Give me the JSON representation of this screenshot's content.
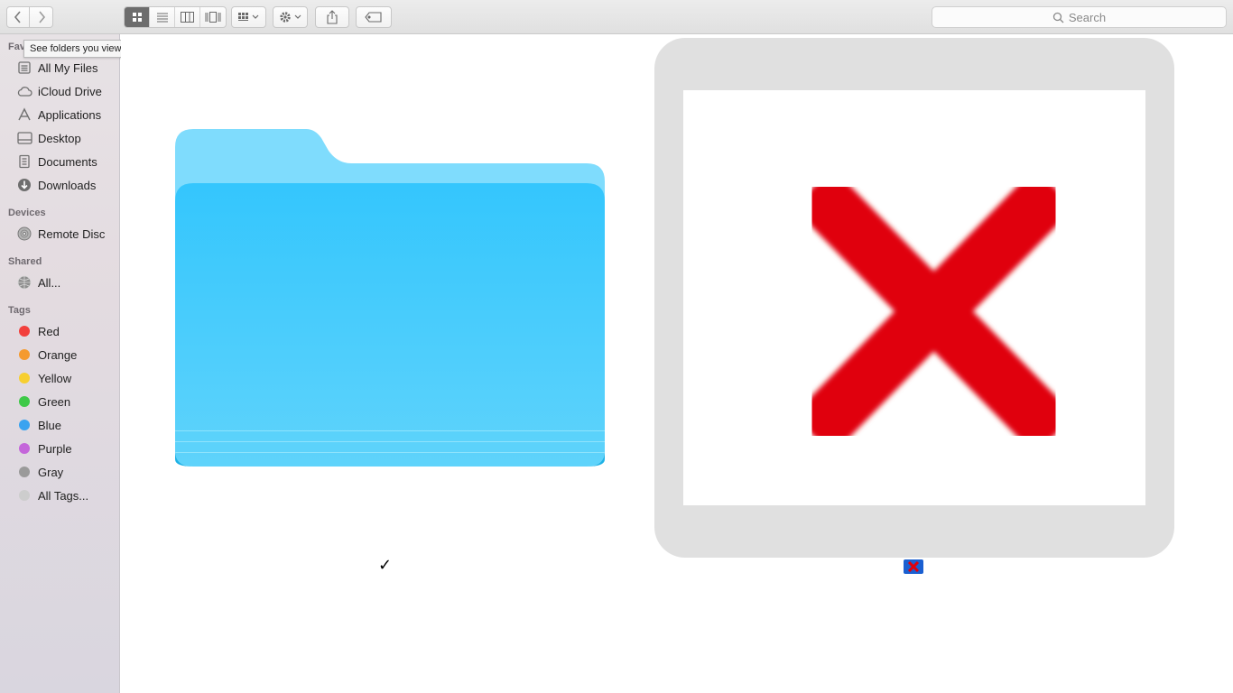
{
  "toolbar": {
    "back_icon": "chevron-left-icon",
    "forward_icon": "chevron-right-icon",
    "view_modes": [
      "icon-view-icon",
      "list-view-icon",
      "column-view-icon",
      "cover-flow-icon"
    ],
    "active_view": "icon-view-icon",
    "arrange_icon": "arrange-grid-icon",
    "action_icon": "gear-icon",
    "share_icon": "share-icon",
    "tag_icon": "tag-icon",
    "search_placeholder": "Search"
  },
  "tooltip": {
    "text": "See folders you viewed previously"
  },
  "sidebar": {
    "favorites_header": "Fav",
    "favorites": [
      {
        "label": "All My Files",
        "icon": "all-files-icon"
      },
      {
        "label": "iCloud Drive",
        "icon": "cloud-icon"
      },
      {
        "label": "Applications",
        "icon": "applications-icon"
      },
      {
        "label": "Desktop",
        "icon": "desktop-icon"
      },
      {
        "label": "Documents",
        "icon": "documents-icon"
      },
      {
        "label": "Downloads",
        "icon": "downloads-icon"
      }
    ],
    "devices_header": "Devices",
    "devices": [
      {
        "label": "Remote Disc",
        "icon": "disc-icon"
      }
    ],
    "shared_header": "Shared",
    "shared": [
      {
        "label": "All...",
        "icon": "network-icon"
      }
    ],
    "tags_header": "Tags",
    "tags": [
      {
        "label": "Red",
        "color": "#f2403d"
      },
      {
        "label": "Orange",
        "color": "#f59a2f"
      },
      {
        "label": "Yellow",
        "color": "#f7cf30"
      },
      {
        "label": "Green",
        "color": "#3ec948"
      },
      {
        "label": "Blue",
        "color": "#3aa3f0"
      },
      {
        "label": "Purple",
        "color": "#c466da"
      },
      {
        "label": "Gray",
        "color": "#9a9a9a"
      },
      {
        "label": "All Tags...",
        "color": "#cdcdcd"
      }
    ]
  },
  "content": {
    "folder_icon": "folder-icon",
    "check_mark": "✓",
    "preview_icon": "red-x-icon",
    "mini_icon": "small-x-icon",
    "accent": "#3ac4fb",
    "x_color": "#e0000c"
  }
}
